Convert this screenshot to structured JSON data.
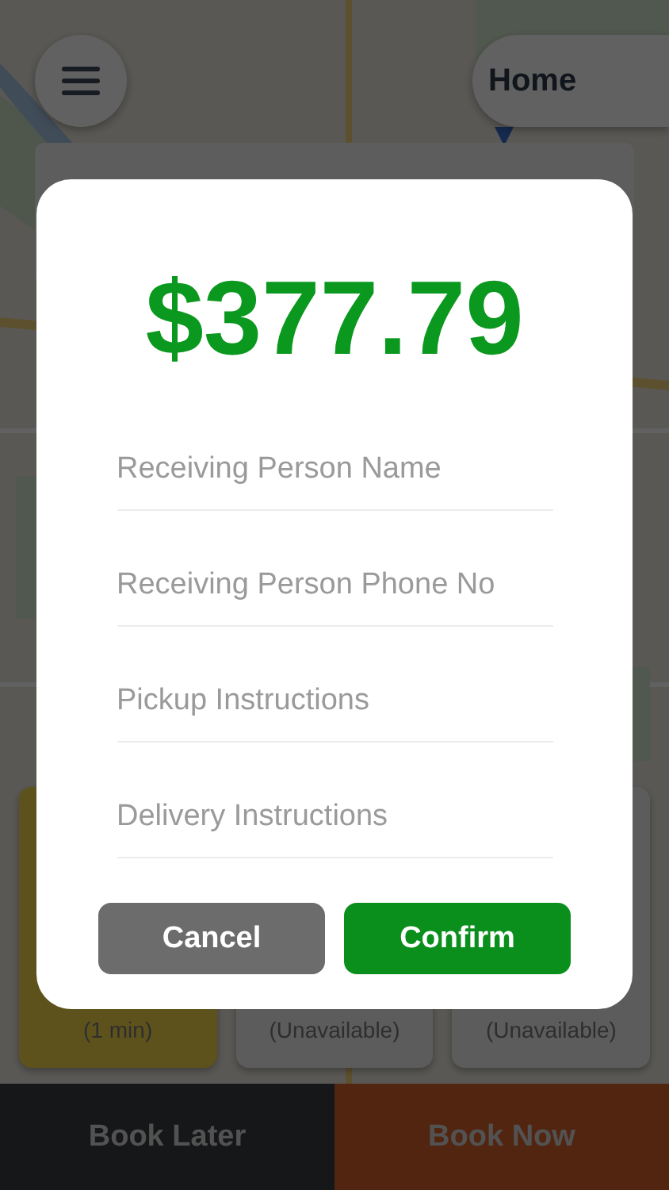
{
  "top_bar": {
    "destination": "Home"
  },
  "vehicles": [
    {
      "eta": "(1 min)",
      "selected": true
    },
    {
      "eta": "(Unavailable)",
      "selected": false
    },
    {
      "eta": "(Unavailable)",
      "selected": false
    }
  ],
  "actions": [
    {
      "label": "Book Later",
      "kind": "later"
    },
    {
      "label": "Book Now",
      "kind": "now"
    }
  ],
  "dialog": {
    "price": "$377.79",
    "fields": [
      {
        "placeholder": "Receiving Person Name"
      },
      {
        "placeholder": "Receiving Person Phone No"
      },
      {
        "placeholder": "Pickup Instructions"
      },
      {
        "placeholder": "Delivery Instructions"
      }
    ],
    "buttons": [
      {
        "label": "Cancel",
        "kind": "cancel"
      },
      {
        "label": "Confirm",
        "kind": "confirm"
      }
    ]
  }
}
